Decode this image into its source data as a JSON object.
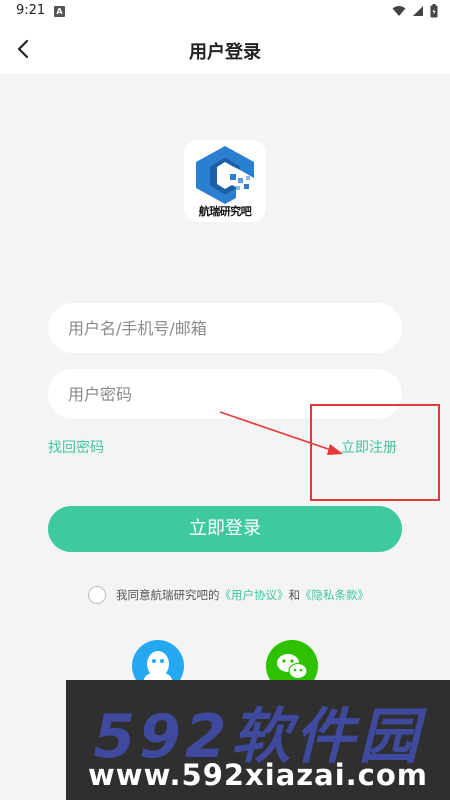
{
  "status_bar": {
    "time": "9:21",
    "a_icon": "A"
  },
  "nav": {
    "title": "用户登录"
  },
  "logo": {
    "text": "航瑞研究吧",
    "color": "#2a7fd0"
  },
  "form": {
    "username_placeholder": "用户名/手机号/邮箱",
    "password_placeholder": "用户密码",
    "forgot_label": "找回密码",
    "register_label": "立即注册",
    "login_label": "立即登录"
  },
  "agreement": {
    "prefix": "我同意航瑞研究吧的",
    "user_agreement": "《用户协议》",
    "and": "和",
    "privacy": "《隐私条款》"
  },
  "social": {
    "qq_icon": "qq-icon",
    "wechat_icon": "wechat-icon"
  },
  "watermark": {
    "title": "592软件园",
    "url": "www.592xiazai.com"
  },
  "colors": {
    "accent": "#3ec9a0",
    "link": "#3fc6a1",
    "annotation": "#e53a3a"
  }
}
